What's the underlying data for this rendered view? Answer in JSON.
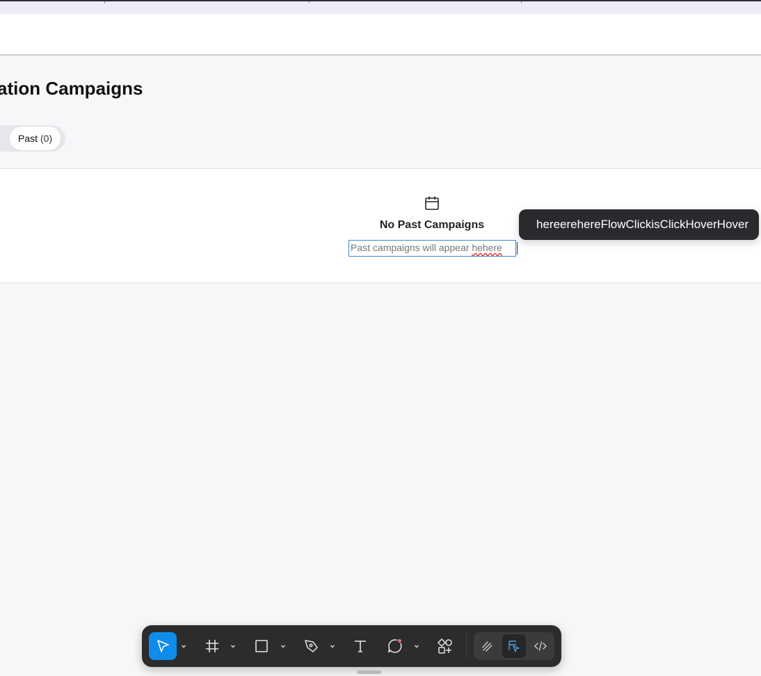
{
  "page": {
    "title": "ation Campaigns"
  },
  "tabs": [
    {
      "label": "Past",
      "count": "(0)"
    }
  ],
  "empty_state": {
    "icon": "calendar-icon",
    "title": "No Past Campaigns",
    "description_prefix": "Past campaigns will appear ",
    "description_misspelled": "hehere"
  },
  "tooltip": {
    "text": "hereerehereFlowClickisClickHoverHover"
  },
  "toolbar": {
    "tools": [
      {
        "name": "move-tool",
        "icon": "cursor-arrow-icon",
        "active": true
      },
      {
        "name": "frame-tool",
        "icon": "hash-frame-icon"
      },
      {
        "name": "rectangle-tool",
        "icon": "square-icon"
      },
      {
        "name": "pen-tool",
        "icon": "pen-nib-icon"
      },
      {
        "name": "text-tool",
        "icon": "text-t-icon"
      },
      {
        "name": "comment-tool",
        "icon": "comment-bubble-icon"
      },
      {
        "name": "actions-tool",
        "icon": "shapes-plus-icon"
      }
    ],
    "modes": [
      {
        "name": "draw-mode",
        "icon": "scribble-icon"
      },
      {
        "name": "design-mode",
        "icon": "design-cursor-icon",
        "active": true
      },
      {
        "name": "dev-mode",
        "icon": "code-brackets-icon"
      }
    ],
    "accent_color": "#0d8ce9"
  }
}
